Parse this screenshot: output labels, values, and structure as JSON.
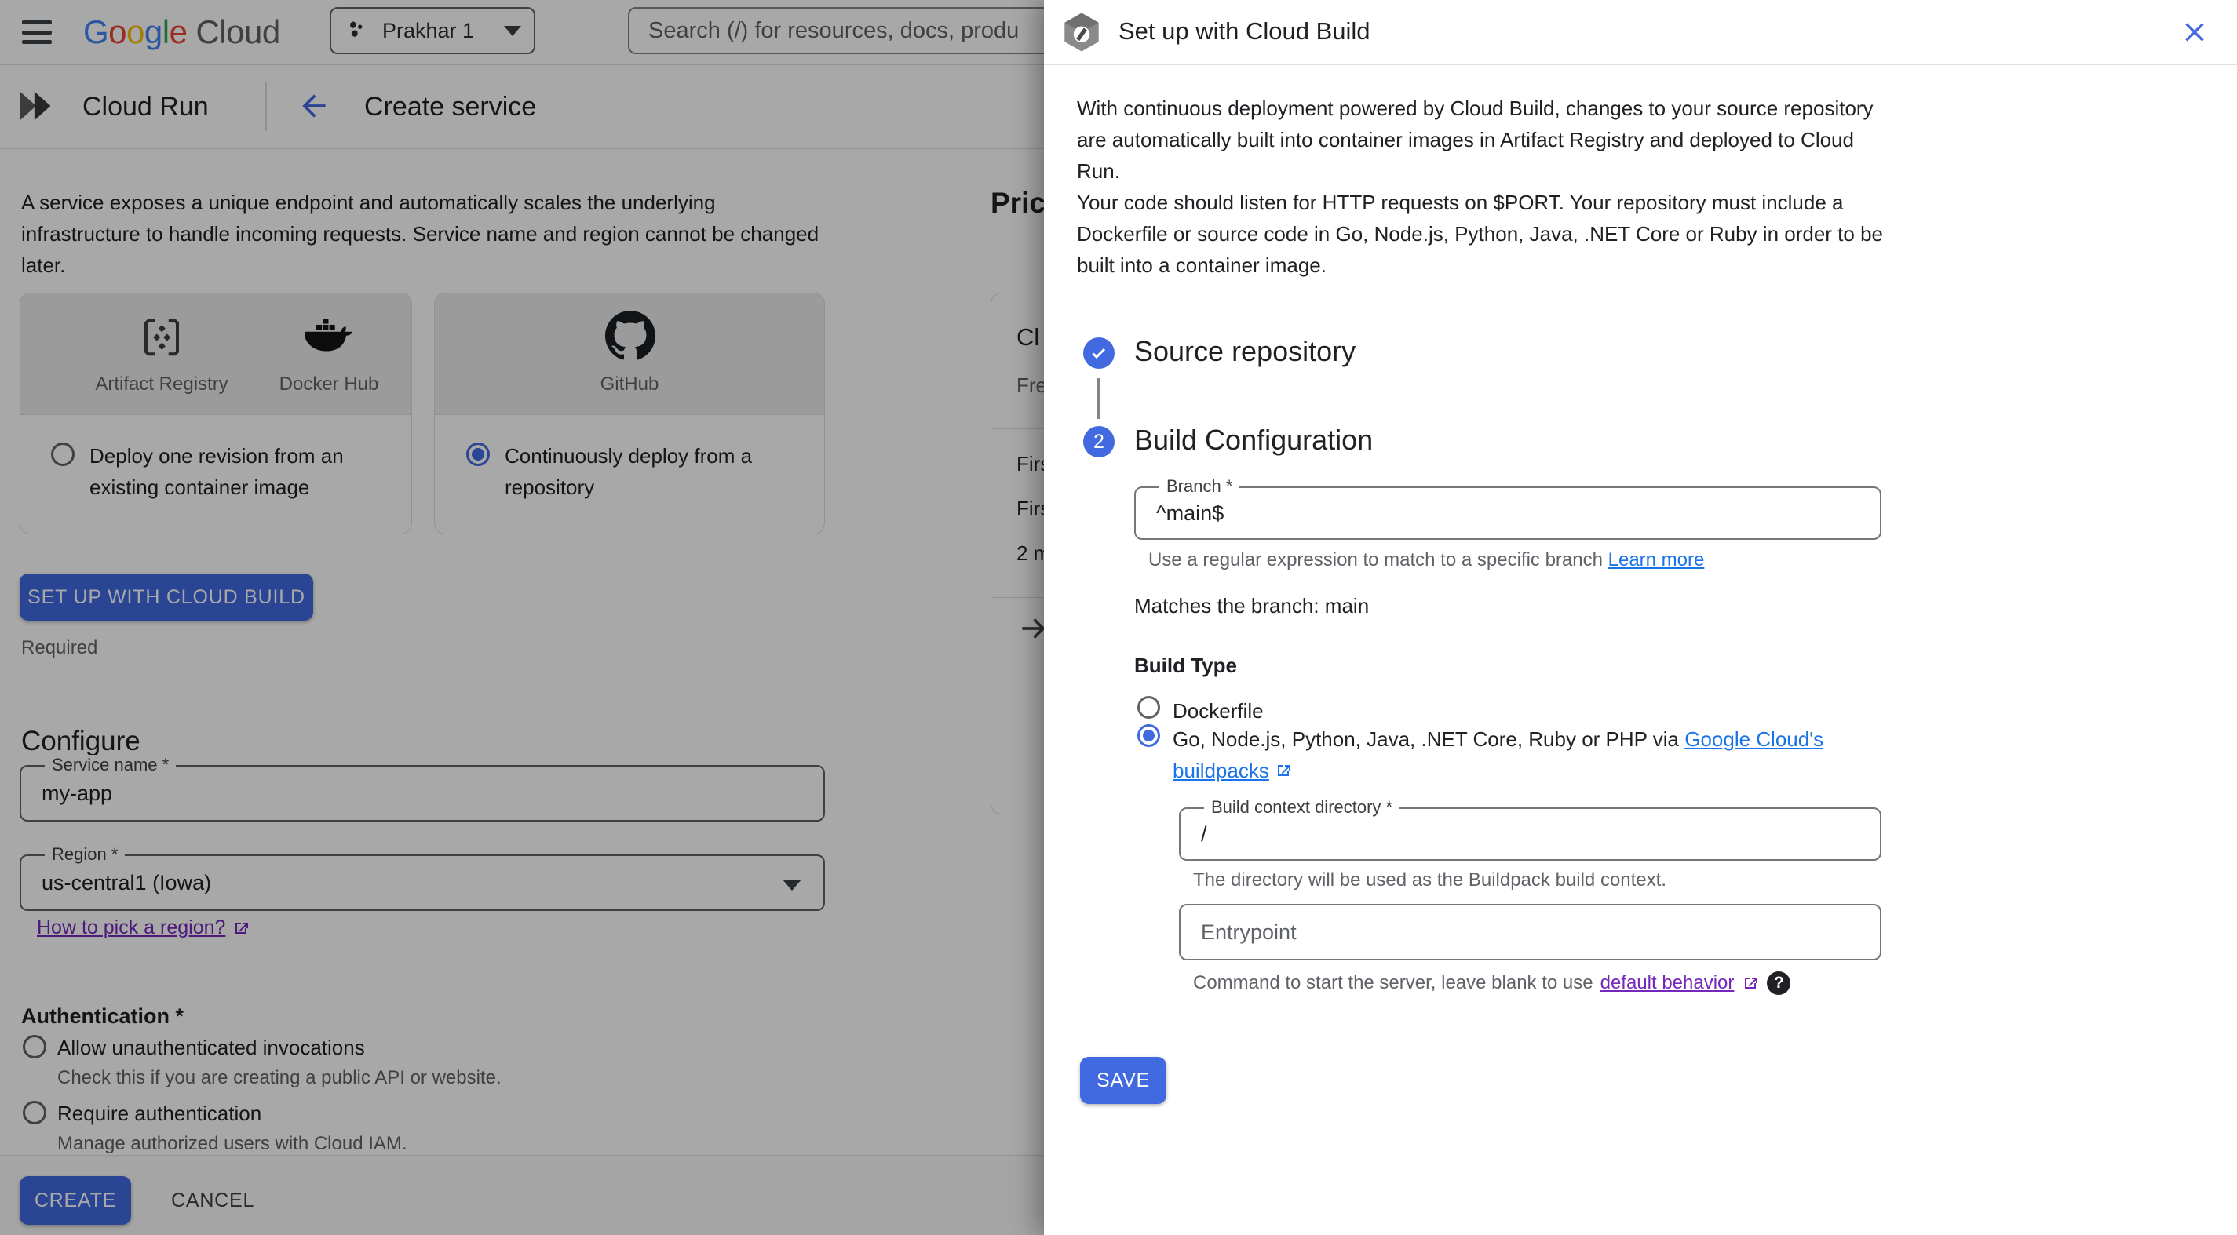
{
  "colors": {
    "primary": "#4169e0",
    "link_blue": "#1a73e8",
    "link_purple": "#7627bb",
    "scrim": "rgba(0,0,0,0.34)"
  },
  "topbar": {
    "logo_letters": [
      "G",
      "o",
      "o",
      "g",
      "l",
      "e"
    ],
    "logo_suffix": "Cloud",
    "project_name": "Prakhar 1",
    "search_placeholder": "Search (/) for resources, docs, produ"
  },
  "header": {
    "product": "Cloud Run",
    "title": "Create service"
  },
  "intro": "A service exposes a unique endpoint and automatically scales the underlying infrastructure to handle incoming requests. Service name and region cannot be changed later.",
  "cards": {
    "registry": {
      "label_artifact": "Artifact Registry",
      "label_docker": "Docker Hub",
      "option": "Deploy one revision from an existing container image"
    },
    "github": {
      "label": "GitHub",
      "option": "Continuously deploy from a repository"
    }
  },
  "setup_button_label": "SET UP WITH CLOUD BUILD",
  "required_note": "Required",
  "configure": {
    "heading": "Configure",
    "service_name": {
      "label": "Service name *",
      "value": "my-app"
    },
    "region": {
      "label": "Region *",
      "value": "us-central1 (Iowa)"
    },
    "region_link": "How to pick a region?"
  },
  "auth": {
    "heading": "Authentication *",
    "options": [
      {
        "label": "Allow unauthenticated invocations",
        "help": "Check this if you are creating a public API or website."
      },
      {
        "label": "Require authentication",
        "help": "Manage authorized users with Cloud IAM."
      }
    ]
  },
  "footer": {
    "create": "CREATE",
    "cancel": "CANCEL"
  },
  "pricing": {
    "heading": "Pric",
    "card_title": "Cl",
    "card_subtitle": "Fre",
    "rows": [
      "Firs",
      "Firs",
      "2 m"
    ]
  },
  "panel": {
    "title": "Set up with Cloud Build",
    "intro1": "With continuous deployment powered by Cloud Build, changes to your source repository are automatically built into container images in Artifact Registry and deployed to Cloud Run.",
    "intro2": "Your code should listen for HTTP requests on $PORT. Your repository must include a Dockerfile or source code in Go, Node.js, Python, Java, .NET Core or Ruby in order to be built into a container image.",
    "step1_title": "Source repository",
    "step2_number": "2",
    "step2_title": "Build Configuration",
    "branch": {
      "label": "Branch *",
      "value": "^main$",
      "help": "Use a regular expression to match to a specific branch ",
      "help_link": "Learn more"
    },
    "matches_text": "Matches the branch: main",
    "build_type": {
      "heading": "Build Type",
      "dockerfile": "Dockerfile",
      "buildpacks_prefix": "Go, Node.js, Python, Java, .NET Core, Ruby or PHP via ",
      "buildpacks_link_line1": "Google Cloud's",
      "buildpacks_link_line2": "buildpacks"
    },
    "context_dir": {
      "label": "Build context directory *",
      "value": "/",
      "help": "The directory will be used as the Buildpack build context."
    },
    "entrypoint": {
      "placeholder": "Entrypoint",
      "help_prefix": "Command to start the server, leave blank to use ",
      "help_link": "default behavior"
    },
    "save_label": "SAVE"
  }
}
